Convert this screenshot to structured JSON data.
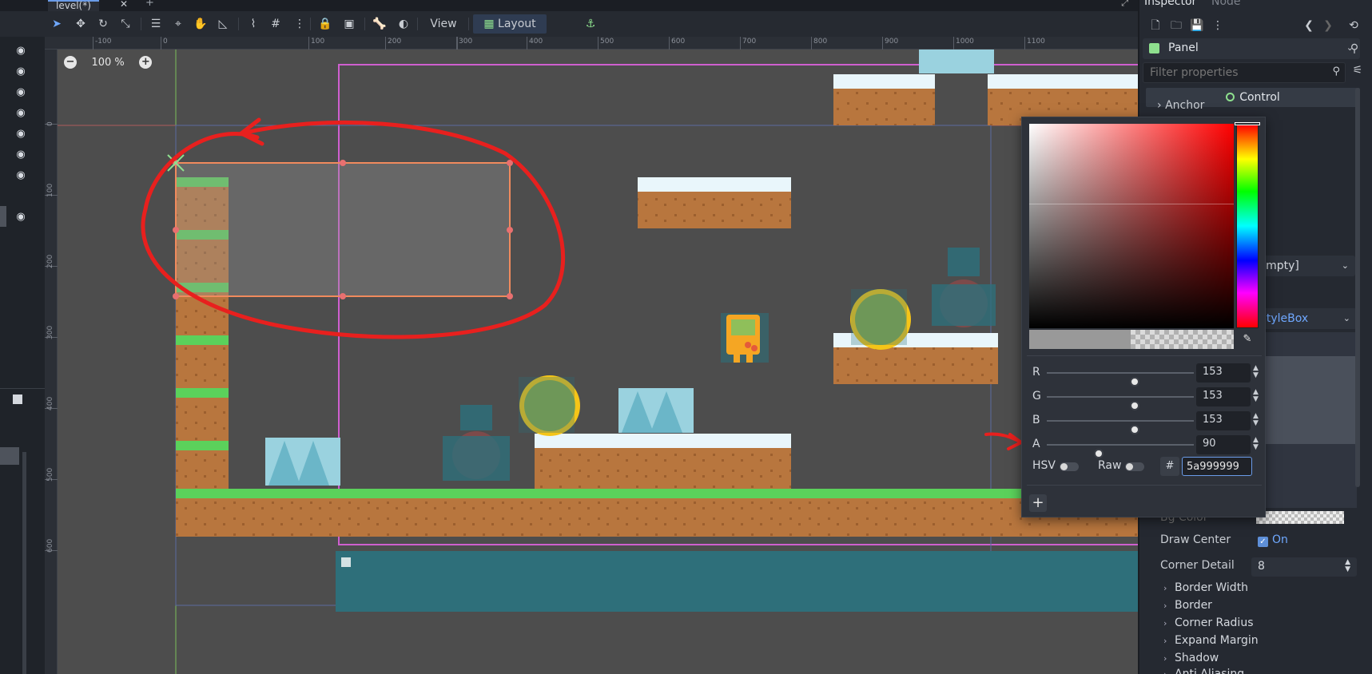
{
  "scene_tab": {
    "label": "level(*)",
    "close": "✕",
    "add": "+"
  },
  "toolbar": {
    "view_label": "View",
    "layout_label": "Layout"
  },
  "ruler": {
    "h_ticks": [
      "-100",
      "0",
      "100",
      "200",
      "300",
      "400",
      "500",
      "600",
      "700",
      "800",
      "900",
      "1000",
      "1100"
    ],
    "v_ticks": [
      "0",
      "100",
      "200",
      "300",
      "400",
      "500",
      "600"
    ]
  },
  "zoom": {
    "minus": "−",
    "value": "100 %",
    "plus": "+"
  },
  "inspector": {
    "tab_inspector": "Inspector",
    "tab_node": "Node",
    "node_type": "Panel",
    "filter_placeholder": "Filter properties",
    "section_control": "Control",
    "anchor_label": "Anchor",
    "empty_value": "[empty]",
    "stylebox_value": "StyleBox",
    "bg_color_label": "Bg Color",
    "draw_center_label": "Draw Center",
    "draw_center_value": "On",
    "corner_detail_label": "Corner Detail",
    "corner_detail_value": "8",
    "groups": [
      "Border Width",
      "Border",
      "Corner Radius",
      "Expand Margin",
      "Shadow",
      "Anti Aliasing"
    ]
  },
  "color_picker": {
    "r_label": "R",
    "r_value": "153",
    "r_fraction": 0.6,
    "g_label": "G",
    "g_value": "153",
    "g_fraction": 0.6,
    "b_label": "B",
    "b_value": "153",
    "b_fraction": 0.6,
    "a_label": "A",
    "a_value": "90",
    "a_fraction": 0.353,
    "hsv_label": "HSV",
    "raw_label": "Raw",
    "hash_label": "#",
    "hex_value": "5a999999",
    "add_preset": "+"
  },
  "colors": {
    "annotation_red": "#e8201e",
    "selection_orange": "#f08a5d",
    "viewport_bg": "#4d4d4d",
    "accent_blue": "#6a9be8",
    "grass_green": "#5bd15b",
    "dirt_brown": "#b8763e"
  }
}
